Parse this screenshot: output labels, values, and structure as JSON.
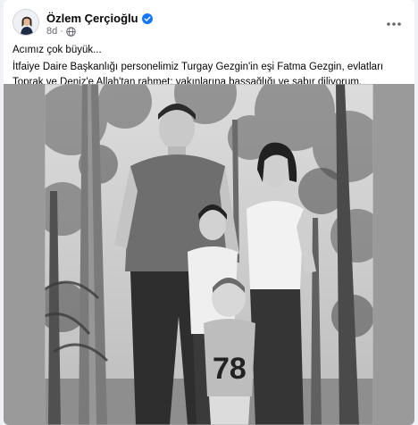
{
  "post": {
    "author_name": "Özlem Çerçioğlu",
    "time_ago": "8d",
    "meta_separator": "·",
    "line1": "Acımız çok büyük...",
    "line2": "İtfaiye Daire Başkanlığı personelimiz Turgay Gezgin'in eşi Fatma Gezgin, evlatları Toprak ve Deniz'e Allah'tan rahmet; yakınlarına başsağlığı ve sabır diliyorum.",
    "more_icon": "more-horizontal-icon",
    "verified_icon": "verified-badge-icon",
    "privacy_icon": "globe-icon",
    "image_alt": "Black and white family photo: a man, a woman and two children standing among trees",
    "colors": {
      "verified": "#1877f2",
      "meta_text": "#65676b"
    }
  }
}
